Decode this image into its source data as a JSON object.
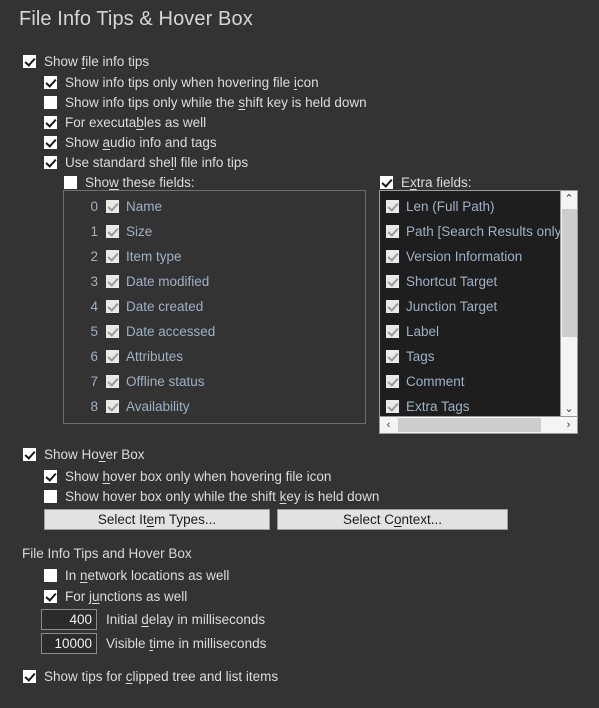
{
  "page": {
    "title": "File Info Tips & Hover Box",
    "background_color": "#333333",
    "text_color": "#dcdcdc",
    "list_text_color": "#9fb1c4",
    "button_color": "#e2e2e2"
  },
  "info_tips": {
    "show_file_info_tips": {
      "label_pre": "Show ",
      "accel": "f",
      "label_post": "ile info tips",
      "checked": true
    },
    "children": [
      {
        "label_pre": "Show info tips only when hovering file ",
        "accel": "i",
        "label_post": "con",
        "checked": true
      },
      {
        "label_pre": "Show info tips only while the ",
        "accel": "s",
        "label_post": "hift key is held down",
        "checked": false
      },
      {
        "label_pre": "For executa",
        "accel": "b",
        "label_post": "les as well",
        "checked": true
      },
      {
        "label_pre": "Show ",
        "accel": "a",
        "label_post": "udio info and tags",
        "checked": true
      },
      {
        "label_pre": "Use standard she",
        "accel": "l",
        "label_post": "l file info tips",
        "checked": true
      }
    ]
  },
  "fields_panel": {
    "header": {
      "label_pre": "Sho",
      "accel": "w",
      "label_post": " these fields:",
      "checked": false
    },
    "items": [
      {
        "index": "0",
        "label": "Name",
        "checked": true
      },
      {
        "index": "1",
        "label": "Size",
        "checked": true
      },
      {
        "index": "2",
        "label": "Item type",
        "checked": true
      },
      {
        "index": "3",
        "label": "Date modified",
        "checked": true
      },
      {
        "index": "4",
        "label": "Date created",
        "checked": true
      },
      {
        "index": "5",
        "label": "Date accessed",
        "checked": true
      },
      {
        "index": "6",
        "label": "Attributes",
        "checked": true
      },
      {
        "index": "7",
        "label": "Offline status",
        "checked": true
      },
      {
        "index": "8",
        "label": "Availability",
        "checked": true
      }
    ]
  },
  "extra_panel": {
    "header": {
      "label_pre": "E",
      "accel": "x",
      "label_post": "tra fields:",
      "checked": true
    },
    "items": [
      {
        "label": "Len (Full Path)",
        "checked": true
      },
      {
        "label": "Path [Search Results only]",
        "checked": true
      },
      {
        "label": "Version Information",
        "checked": true
      },
      {
        "label": "Shortcut Target",
        "checked": true
      },
      {
        "label": "Junction Target",
        "checked": true
      },
      {
        "label": "Label",
        "checked": true
      },
      {
        "label": "Tags",
        "checked": true
      },
      {
        "label": "Comment",
        "checked": true
      },
      {
        "label": "Extra Tags",
        "checked": true
      }
    ],
    "scrollbars": {
      "up_arrow": "⌃",
      "down_arrow": "⌄",
      "left_arrow": "‹",
      "right_arrow": "›"
    }
  },
  "hover_box": {
    "show_hover_box": {
      "label_pre": "Show Ho",
      "accel": "v",
      "label_post": "er Box",
      "checked": true
    },
    "children": [
      {
        "label_pre": "Show ",
        "accel": "h",
        "label_post": "over box only when hovering file icon",
        "checked": true
      },
      {
        "label_pre": "Show hover box only while the shift ",
        "accel": "k",
        "label_post": "ey is held down",
        "checked": false
      }
    ],
    "buttons": [
      {
        "label_pre": "Select It",
        "accel": "e",
        "label_post": "m Types..."
      },
      {
        "label_pre": "Select C",
        "accel": "o",
        "label_post": "ntext..."
      }
    ]
  },
  "common_section": {
    "group_label": "File Info Tips and Hover Box",
    "checkboxes": [
      {
        "label_pre": "In ",
        "accel": "n",
        "label_post": "etwork locations as well",
        "checked": false
      },
      {
        "label_pre": "For j",
        "accel": "u",
        "label_post": "nctions as well",
        "checked": true
      }
    ],
    "numbers": [
      {
        "value": "400",
        "label_pre": "Initial ",
        "accel": "d",
        "label_post": "elay in milliseconds"
      },
      {
        "value": "10000",
        "label_pre": "Visible ",
        "accel": "t",
        "label_post": "ime in milliseconds"
      }
    ]
  },
  "footer": {
    "show_clipped_tips": {
      "label_pre": "Show tips for ",
      "accel": "c",
      "label_post": "lipped tree and list items",
      "checked": true
    }
  }
}
